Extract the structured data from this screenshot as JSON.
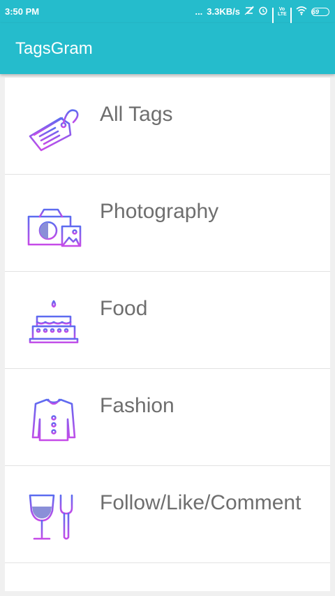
{
  "status_bar": {
    "time": "3:50 PM",
    "dots": "...",
    "speed": "3.3KB/s",
    "volte": "Vo LTE",
    "battery": "69"
  },
  "app_bar": {
    "title": "TagsGram"
  },
  "categories": [
    {
      "label": "All Tags",
      "icon": "tag-icon"
    },
    {
      "label": "Photography",
      "icon": "camera-icon"
    },
    {
      "label": "Food",
      "icon": "cake-icon"
    },
    {
      "label": "Fashion",
      "icon": "shirt-icon"
    },
    {
      "label": "Follow/Like/Comment",
      "icon": "wine-fork-icon"
    }
  ],
  "colors": {
    "primary": "#25bccc",
    "icon_gradient_start": "#5b6cf0",
    "icon_gradient_end": "#c64be8",
    "label_text": "#6e6e6e"
  }
}
